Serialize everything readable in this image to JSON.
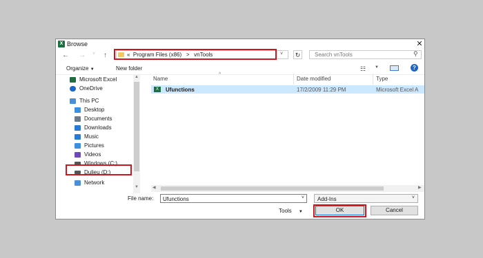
{
  "window": {
    "title": "Browse",
    "app_icon": "excel-icon",
    "close_glyph": "✕"
  },
  "address": {
    "overflow": "«",
    "crumbs": [
      "Program Files (x86)",
      "vnTools"
    ],
    "separator": ">"
  },
  "search": {
    "placeholder": "Search vnTools"
  },
  "toolbar": {
    "organize": "Organize",
    "new_folder": "New folder",
    "help": "?"
  },
  "nav": {
    "items": [
      {
        "label": "Microsoft Excel",
        "icon": "excel-icon",
        "color": "#1d6f42"
      },
      {
        "label": "OneDrive",
        "icon": "cloud-icon",
        "color": "#1a66c9"
      },
      {
        "label": "This PC",
        "icon": "computer-icon",
        "color": "#4a90d9"
      },
      {
        "label": "Desktop",
        "icon": "desktop-icon",
        "color": "#3b8ee0"
      },
      {
        "label": "Documents",
        "icon": "documents-icon",
        "color": "#6c7a8a"
      },
      {
        "label": "Downloads",
        "icon": "downloads-icon",
        "color": "#2a7ad1"
      },
      {
        "label": "Music",
        "icon": "music-icon",
        "color": "#2a7ad1"
      },
      {
        "label": "Pictures",
        "icon": "pictures-icon",
        "color": "#3b8ee0"
      },
      {
        "label": "Videos",
        "icon": "videos-icon",
        "color": "#6c4ab8"
      },
      {
        "label": "Windows (C:)",
        "icon": "drive-icon",
        "color": "#555555"
      },
      {
        "label": "Dulieu (D:)",
        "icon": "drive-icon",
        "color": "#555555"
      },
      {
        "label": "Network",
        "icon": "network-icon",
        "color": "#4a90d9"
      }
    ]
  },
  "columns": {
    "name": "Name",
    "date": "Date modified",
    "type": "Type"
  },
  "files": [
    {
      "name": "Ufunctions",
      "date": "17/2/2009 11:29 PM",
      "type": "Microsoft Excel A"
    }
  ],
  "footer": {
    "file_name_label": "File name:",
    "file_name_value": "Ufunctions",
    "file_type_value": "Add-Ins",
    "tools": "Tools",
    "ok": "OK",
    "cancel": "Cancel"
  },
  "highlight_color": "#d0141c"
}
